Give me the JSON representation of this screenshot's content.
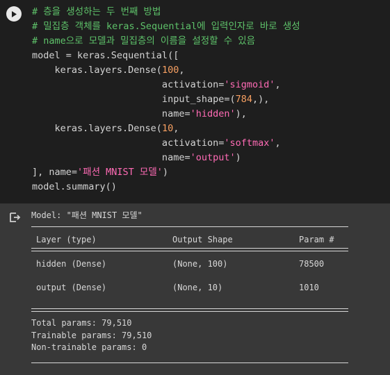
{
  "cell": {
    "run_icon": "play-icon",
    "lines": [
      [
        {
          "t": "# 층을 생성하는 두 번째 방법",
          "c": "comment"
        }
      ],
      [
        {
          "t": "# 밀집층 객체를 keras.Sequential에 입력인자로 바로 생성",
          "c": "comment"
        }
      ],
      [
        {
          "t": "# name으로 모델과 밀집층의 이름을 설정할 수 있음",
          "c": "comment"
        }
      ],
      [
        {
          "t": "model = keras.Sequential([",
          "c": "plain"
        }
      ],
      [
        {
          "t": "    keras.layers.Dense(",
          "c": "plain"
        },
        {
          "t": "100",
          "c": "num"
        },
        {
          "t": ",",
          "c": "plain"
        }
      ],
      [
        {
          "t": "                       activation=",
          "c": "plain"
        },
        {
          "t": "'sigmoid'",
          "c": "str"
        },
        {
          "t": ",",
          "c": "plain"
        }
      ],
      [
        {
          "t": "                       input_shape=(",
          "c": "plain"
        },
        {
          "t": "784",
          "c": "num"
        },
        {
          "t": ",),",
          "c": "plain"
        }
      ],
      [
        {
          "t": "                       name=",
          "c": "plain"
        },
        {
          "t": "'hidden'",
          "c": "str"
        },
        {
          "t": "),",
          "c": "plain"
        }
      ],
      [
        {
          "t": "    keras.layers.Dense(",
          "c": "plain"
        },
        {
          "t": "10",
          "c": "num"
        },
        {
          "t": ",",
          "c": "plain"
        }
      ],
      [
        {
          "t": "                       activation=",
          "c": "plain"
        },
        {
          "t": "'softmax'",
          "c": "str"
        },
        {
          "t": ",",
          "c": "plain"
        }
      ],
      [
        {
          "t": "                       name=",
          "c": "plain"
        },
        {
          "t": "'output'",
          "c": "str"
        },
        {
          "t": ")",
          "c": "plain"
        }
      ],
      [
        {
          "t": "], name=",
          "c": "plain"
        },
        {
          "t": "'패션 MNIST 모델'",
          "c": "str"
        },
        {
          "t": ")",
          "c": "plain"
        }
      ],
      [
        {
          "t": "model.summary()",
          "c": "plain"
        }
      ]
    ]
  },
  "output": {
    "icon": "output-redirect-icon",
    "model_line": "Model: \"패션 MNIST 모델\"",
    "headers": [
      "Layer (type)",
      "Output Shape",
      "Param #"
    ],
    "rows": [
      [
        "hidden (Dense)",
        "(None, 100)",
        "78500"
      ],
      [
        "output (Dense)",
        "(None, 10)",
        "1010"
      ]
    ],
    "total_params": "Total params: 79,510",
    "trainable_params": "Trainable params: 79,510",
    "non_trainable_params": "Non-trainable params: 0"
  }
}
